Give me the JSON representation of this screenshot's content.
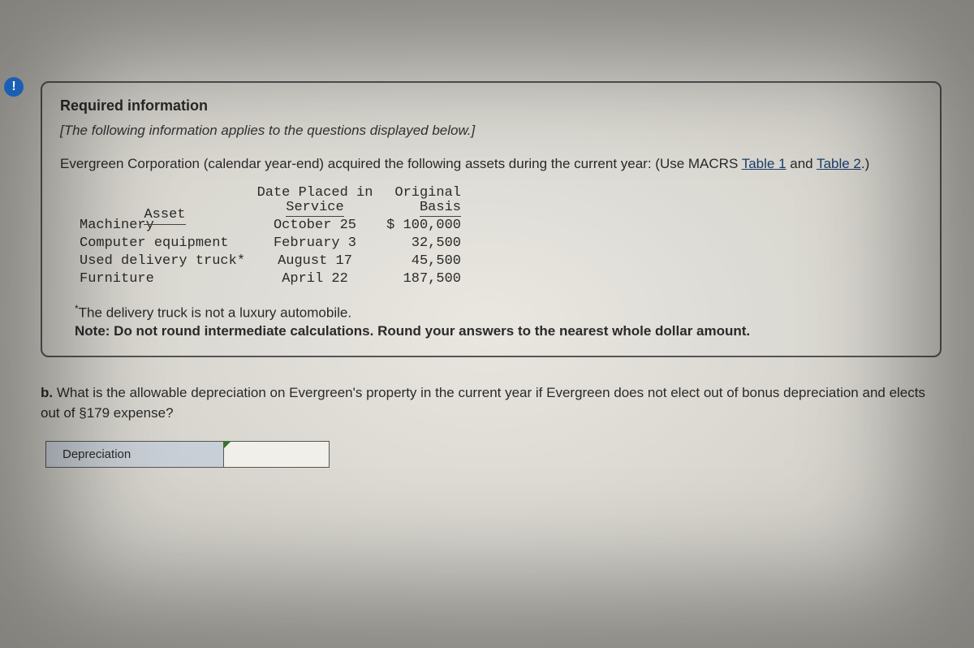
{
  "alert_symbol": "!",
  "heading": "Required information",
  "italic_note": "[The following information applies to the questions displayed below.]",
  "intro_pre": "Evergreen Corporation (calendar year-end) acquired the following assets during the current year: (Use MACRS ",
  "link_table1": "Table 1",
  "intro_mid": " and ",
  "link_table2": "Table 2",
  "intro_post": ".)",
  "table_headers": {
    "asset": "Asset",
    "date_l1": "Date Placed in",
    "date_l2": "Service",
    "basis_l1": "Original",
    "basis_l2": "Basis"
  },
  "rows": [
    {
      "asset": "Machinery",
      "date": "October 25",
      "basis": "$ 100,000"
    },
    {
      "asset": "Computer equipment",
      "date": "February 3",
      "basis": "32,500"
    },
    {
      "asset": "Used delivery truck*",
      "date": "August 17",
      "basis": "45,500"
    },
    {
      "asset": "Furniture",
      "date": "April 22",
      "basis": "187,500"
    }
  ],
  "footnote": "The delivery truck is not a luxury automobile.",
  "note_bold": "Note: Do not round intermediate calculations. Round your answers to the nearest whole dollar amount.",
  "question_b_label": "b.",
  "question_b_text": " What is the allowable depreciation on Evergreen's property in the current year if Evergreen does not elect out of bonus depreciation and elects out of §179 expense?",
  "answer_label": "Depreciation",
  "answer_value": ""
}
